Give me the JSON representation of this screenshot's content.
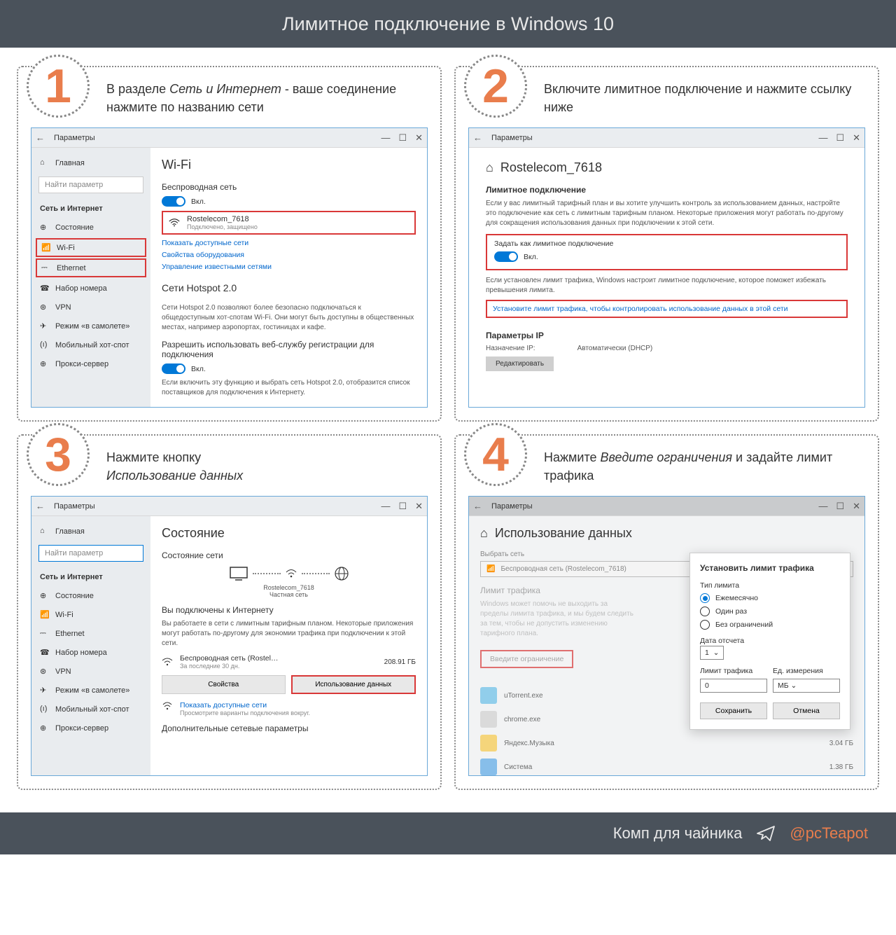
{
  "header_title": "Лимитное подключение в Windows 10",
  "footer_text": "Комп для чайника",
  "footer_handle": "@pcTeapot",
  "steps": [
    {
      "num": "1",
      "text_pre": "В разделе ",
      "text_em": "Сеть и Интернет",
      "text_post": " - ваше соединение нажмите по названию сети"
    },
    {
      "num": "2",
      "text_pre": "Включите лимитное подклю­чение и нажмите ссылку ниже",
      "text_em": "",
      "text_post": ""
    },
    {
      "num": "3",
      "text_pre": "Нажмите кнопку ",
      "text_em": "Использование данных",
      "text_post": ""
    },
    {
      "num": "4",
      "text_pre": "Нажмите ",
      "text_em": "Введите ограничения",
      "text_post": " и задайте лимит трафика"
    }
  ],
  "win": {
    "back": "←",
    "min": "—",
    "max": "☐",
    "close": "✕",
    "params": "Параметры",
    "home": "Главная",
    "search": "Найти параметр",
    "section": "Сеть и Интернет",
    "nav": [
      "Состояние",
      "Wi-Fi",
      "Ethernet",
      "Набор номера",
      "VPN",
      "Режим «в самолете»",
      "Мобильный хот-спот",
      "Прокси-сервер"
    ]
  },
  "s1": {
    "title": "Wi-Fi",
    "wireless": "Беспроводная сеть",
    "on": "Вкл.",
    "ssid": "Rostelecom_7618",
    "ssid_sub": "Подключено, защищено",
    "show_avail": "Показать доступные сети",
    "hw_props": "Свойства оборудования",
    "manage": "Управление известными сетями",
    "hotspot_h": "Сети Hotspot 2.0",
    "hotspot_p": "Сети Hotspot 2.0 позволяют более безопасно подключаться к общедоступным хот-спотам Wi-Fi. Они могут быть доступны в общественных местах, например аэропортах, гостиницах и кафе.",
    "allow": "Разрешить использовать веб-службу регистрации для подключения",
    "hotspot_p2": "Если включить эту функцию и выбрать сеть Hotspot 2.0, отобразится список поставщиков для подключения к Интернету."
  },
  "s2": {
    "title": "Rostelecom_7618",
    "sub": "Лимитное подключение",
    "para": "Если у вас лимитный тарифный план и вы хотите улучшить контроль за использованием данных, настройте это подключение как сеть с лимитным тарифным планом. Некоторые приложения могут работать по-другому для сокращения использования данных при подключении к этой сети.",
    "set_as": "Задать как лимитное подключение",
    "on": "Вкл.",
    "para2": "Если установлен лимит трафика, Windows настроит лимитное подключение, которое поможет избежать превышения лимита.",
    "link": "Установите лимит трафика, чтобы контролировать использование данных в этой сети",
    "ip_h": "Параметры IP",
    "ip_assign": "Назначение IP:",
    "ip_val": "Автоматически (DHCP)",
    "edit": "Редактировать"
  },
  "s3": {
    "title": "Состояние",
    "sub": "Состояние сети",
    "ssid": "Rostelecom_7618",
    "private": "Частная сеть",
    "connected": "Вы подключены к Интернету",
    "para": "Вы работаете в сети с лимитным тарифным планом. Некоторые приложения могут работать по-другому для экономии трафика при подключении к этой сети.",
    "wifi_line": "Беспроводная сеть (Rostel…",
    "period": "За последние 30 дн.",
    "gb": "208.91 ГБ",
    "props": "Свойства",
    "usage": "Использование данных",
    "show": "Показать доступные сети",
    "show_sub": "Просмотрите варианты подключения вокруг.",
    "extra": "Дополнительные сетевые параметры"
  },
  "s4": {
    "title": "Использование данных",
    "pick": "Выбрать сеть",
    "dd": "Беспроводная сеть (Rostelecom_7618)",
    "limit_h": "Лимит трафика",
    "limit_p": "Windows может помочь не выходить за пределы лимита трафика, и мы будем следить за тем, чтобы не допустить изменению тарифного плана.",
    "enter": "Введите ограничение",
    "modal_title": "Установить лимит трафика",
    "type_lbl": "Тип лимита",
    "r1": "Ежемесячно",
    "r2": "Один раз",
    "r3": "Без ограничений",
    "date_lbl": "Дата отсчета",
    "date_val": "1",
    "limit_lbl": "Лимит трафика",
    "unit_lbl": "Ед. измерения",
    "limit_val": "0",
    "unit_val": "МБ",
    "save": "Сохранить",
    "cancel": "Отмена",
    "apps": [
      {
        "name": "uTorrent.exe",
        "size": ""
      },
      {
        "name": "chrome.exe",
        "size": ""
      },
      {
        "name": "Яндекс.Музыка",
        "size": "3.04 ГБ"
      },
      {
        "name": "Система",
        "size": "1.38 ГБ"
      }
    ]
  }
}
